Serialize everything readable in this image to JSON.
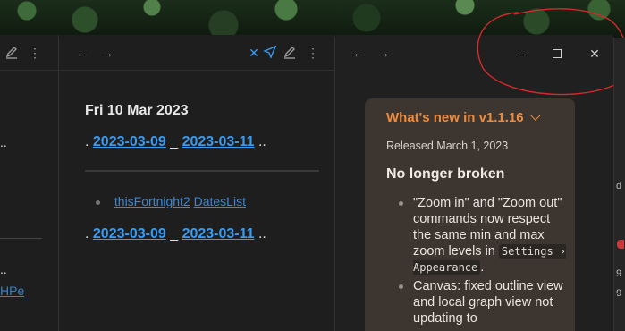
{
  "left_pane": {
    "dots_top": "..",
    "dots_bottom": "..",
    "link_fragment": "HPe"
  },
  "middle_pane": {
    "title": "Fri 10 Mar 2023",
    "prev_date": "2023-03-09",
    "next_date": "2023-03-11",
    "prefix": ".",
    "separator": "_",
    "suffix": "..",
    "list_link_1": "thisFortnight2",
    "list_link_2": "DatesList"
  },
  "right_edge": {
    "char_1": "d",
    "char_2": "9",
    "char_3": "9"
  },
  "release_card": {
    "title": "What's new in v1.1.16",
    "released": "Released March 1, 2023",
    "heading": "No longer broken",
    "item1_text": "\"Zoom in\" and \"Zoom out\" commands now respect the same min and max zoom levels in",
    "item1_kbd": "Settings › Appearance",
    "item1_end": ".",
    "item2_text": "Canvas: fixed outline view and local graph view not updating to"
  },
  "colors": {
    "accent_blue": "#3a9bf0",
    "orange_title": "#ef8b3c",
    "annotation_red": "#d22a2a"
  }
}
